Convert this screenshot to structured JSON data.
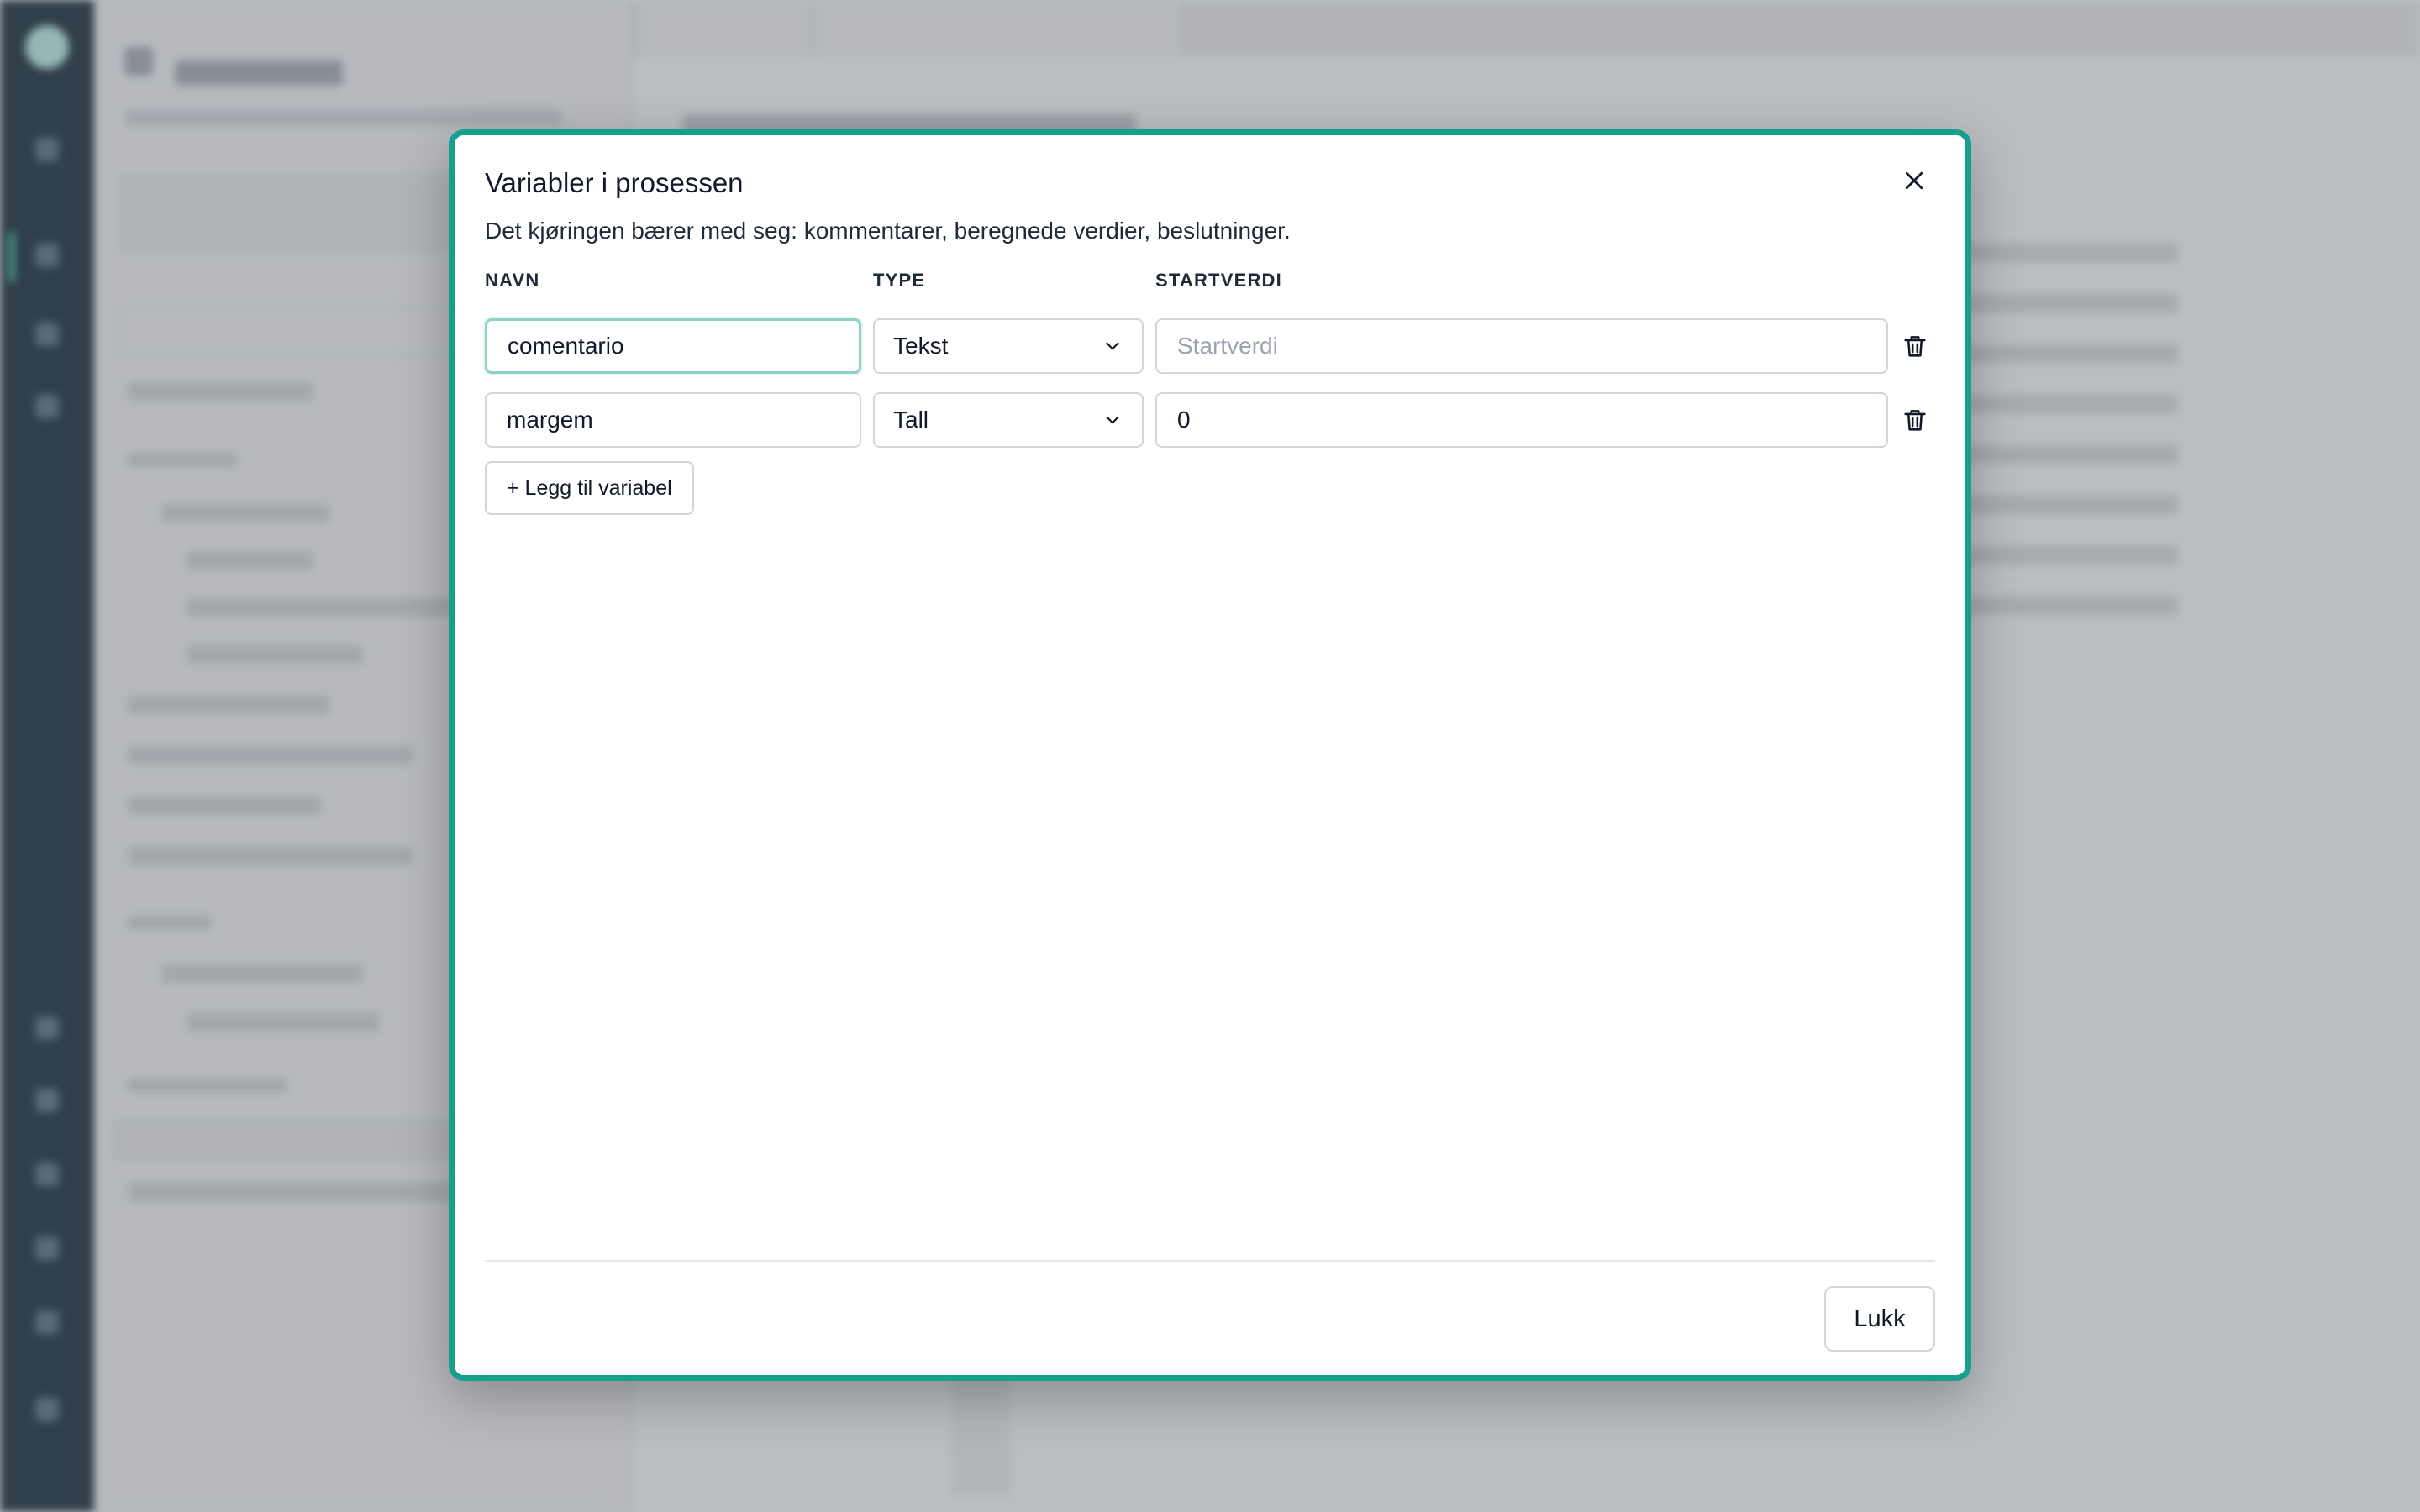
{
  "dialog": {
    "title": "Variabler i prosessen",
    "description": "Det kjøringen bærer med seg: kommentarer, beregnede verdier, beslutninger.",
    "columns": {
      "name": "NAVN",
      "type": "TYPE",
      "start": "STARTVERDI"
    },
    "variables": [
      {
        "name": "comentario",
        "type": "Tekst",
        "start_value": "",
        "start_placeholder": "Startverdi"
      },
      {
        "name": "margem",
        "type": "Tall",
        "start_value": "0",
        "start_placeholder": "Startverdi"
      }
    ],
    "add_label": "+ Legg til variabel",
    "close_label": "Lukk"
  },
  "colors": {
    "accent": "#14a08d",
    "rail": "#1d2f3a"
  },
  "icons": {
    "close": "x-icon",
    "delete": "trash-icon",
    "dropdown": "chevron-down-icon"
  }
}
